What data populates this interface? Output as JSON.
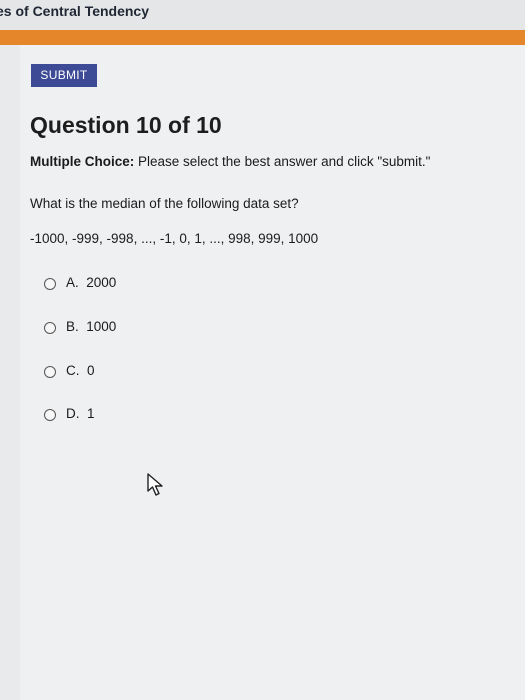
{
  "header": {
    "title": "es of Central Tendency"
  },
  "toolbar": {
    "submit_label": "SUBMIT"
  },
  "question": {
    "title": "Question 10 of 10",
    "type_label": "Multiple Choice:",
    "instruction": " Please select the best answer and click \"submit.\"",
    "prompt": "What is the median of the following data set?",
    "dataset": "-1000, -999, -998, ..., -1, 0, 1, ..., 998, 999, 1000",
    "options": [
      {
        "letter": "A.",
        "value": "2000"
      },
      {
        "letter": "B.",
        "value": "1000"
      },
      {
        "letter": "C.",
        "value": "0"
      },
      {
        "letter": "D.",
        "value": "1"
      }
    ]
  },
  "colors": {
    "accent_bar": "#e6862a",
    "submit_button": "#3d4b96"
  },
  "icons": {
    "radio": "radio-icon",
    "pointer": "mouse-pointer-icon"
  }
}
